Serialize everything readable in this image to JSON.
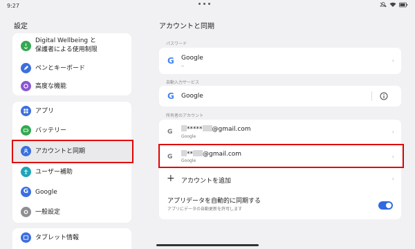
{
  "status": {
    "time": "9:27"
  },
  "left": {
    "title": "設定",
    "group1": [
      {
        "label": "Digital Wellbeing と",
        "label2": "保護者による使用制限",
        "icon": "hourglass-icon",
        "color": "#34a853"
      },
      {
        "label": "ペンとキーボード",
        "icon": "pen-icon",
        "color": "#3b6fe0"
      },
      {
        "label": "高度な機能",
        "icon": "gear-spark-icon",
        "color": "#8a55d6"
      }
    ],
    "group2": [
      {
        "label": "アプリ",
        "icon": "apps-icon",
        "color": "#3b6fe0"
      },
      {
        "label": "バッテリー",
        "icon": "battery-icon",
        "color": "#34a853"
      },
      {
        "label": "アカウントと同期",
        "icon": "account-icon",
        "color": "#3b6fe0"
      },
      {
        "label": "ユーザー補助",
        "icon": "accessibility-icon",
        "color": "#1ea5b8"
      },
      {
        "label": "Google",
        "icon": "google-icon",
        "color": "#3b6fe0"
      },
      {
        "label": "一般設定",
        "icon": "settings-icon",
        "color": "#8e8e93"
      }
    ],
    "group3": [
      {
        "label": "タブレット情報",
        "icon": "tablet-icon",
        "color": "#3b6fe0"
      }
    ]
  },
  "right": {
    "title": "アカウントと同期",
    "password_group": "パスワード",
    "password_item": {
      "title": "Google",
      "sub": "--"
    },
    "autofill_group": "自動入力サービス",
    "autofill_item": {
      "title": "Google"
    },
    "owner_group": "所有者のアカウント",
    "accounts": [
      {
        "suffix": "*****",
        "domain": "@gmail.com",
        "sub": "Google"
      },
      {
        "suffix": "**",
        "domain": "@gmail.com",
        "sub": "Google"
      }
    ],
    "add_account": "アカウントを追加",
    "sync": {
      "title": "アプリデータを自動的に同期する",
      "sub": "アプリにデータの自動更新を許可します",
      "enabled": true
    }
  }
}
